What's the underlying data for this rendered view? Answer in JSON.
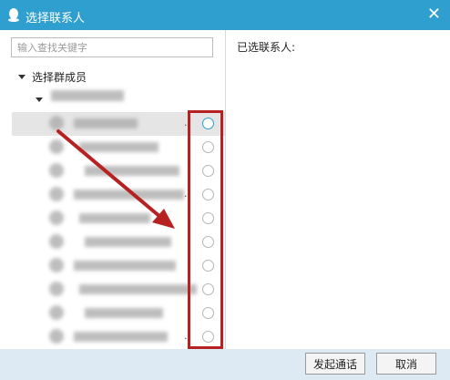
{
  "window": {
    "title": "选择联系人",
    "close_glyph": "✕",
    "title_bg": "#2f9fd0"
  },
  "left": {
    "search_placeholder": "输入查找关键字",
    "group_label": "选择群成员",
    "members": [
      {
        "has_ellipsis": true,
        "selected_style": "active"
      },
      {
        "has_ellipsis": false
      },
      {
        "has_ellipsis": false
      },
      {
        "has_ellipsis": true
      },
      {
        "has_ellipsis": false
      },
      {
        "has_ellipsis": false
      },
      {
        "has_ellipsis": false
      },
      {
        "has_ellipsis": false
      },
      {
        "has_ellipsis": false
      },
      {
        "has_ellipsis": true
      }
    ]
  },
  "right": {
    "selected_label": "已选联系人:"
  },
  "footer": {
    "call_button": "发起通话",
    "cancel_button": "取消",
    "bg": "#dde9f3"
  },
  "annotation": {
    "color": "#b62222"
  }
}
